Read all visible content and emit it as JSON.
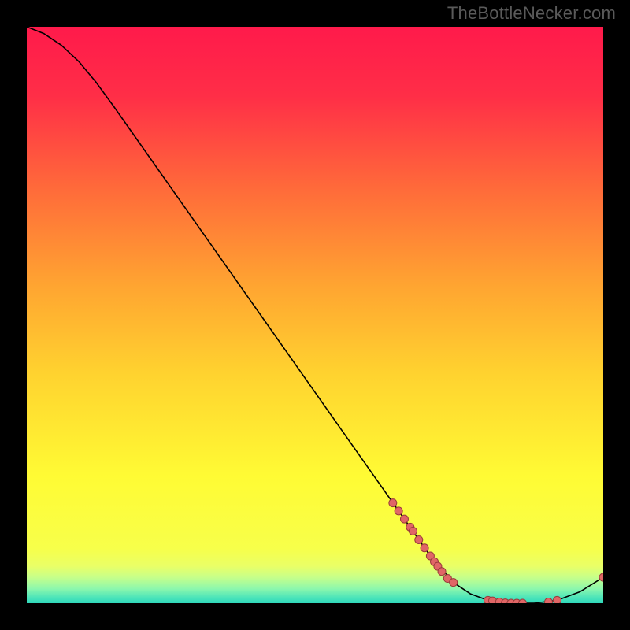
{
  "watermark": "TheBottleNecker.com",
  "chart_data": {
    "type": "line",
    "title": "",
    "xlabel": "",
    "ylabel": "",
    "xlim": [
      0,
      100
    ],
    "ylim": [
      0,
      100
    ],
    "gradient_stops": [
      {
        "offset": 0.0,
        "color": "#ff1a4b"
      },
      {
        "offset": 0.12,
        "color": "#ff2e47"
      },
      {
        "offset": 0.28,
        "color": "#ff6a3a"
      },
      {
        "offset": 0.45,
        "color": "#ffa531"
      },
      {
        "offset": 0.6,
        "color": "#ffd22f"
      },
      {
        "offset": 0.78,
        "color": "#fffb34"
      },
      {
        "offset": 0.905,
        "color": "#f7ff4a"
      },
      {
        "offset": 0.935,
        "color": "#eaff66"
      },
      {
        "offset": 0.955,
        "color": "#c7ff8a"
      },
      {
        "offset": 0.975,
        "color": "#8cf7ad"
      },
      {
        "offset": 0.99,
        "color": "#4de5b9"
      },
      {
        "offset": 1.0,
        "color": "#2fd8bb"
      }
    ],
    "series": [
      {
        "name": "curve",
        "stroke": "#000000",
        "points": [
          {
            "x": 0.0,
            "y": 100.0
          },
          {
            "x": 3.0,
            "y": 98.8
          },
          {
            "x": 6.0,
            "y": 96.8
          },
          {
            "x": 9.0,
            "y": 94.0
          },
          {
            "x": 12.0,
            "y": 90.4
          },
          {
            "x": 15.0,
            "y": 86.3
          },
          {
            "x": 20.0,
            "y": 79.2
          },
          {
            "x": 30.0,
            "y": 65.0
          },
          {
            "x": 40.0,
            "y": 50.8
          },
          {
            "x": 50.0,
            "y": 36.6
          },
          {
            "x": 60.0,
            "y": 22.4
          },
          {
            "x": 70.0,
            "y": 8.2
          },
          {
            "x": 74.0,
            "y": 3.6
          },
          {
            "x": 77.0,
            "y": 1.6
          },
          {
            "x": 80.0,
            "y": 0.5
          },
          {
            "x": 84.0,
            "y": 0.0
          },
          {
            "x": 88.0,
            "y": 0.0
          },
          {
            "x": 92.0,
            "y": 0.5
          },
          {
            "x": 96.0,
            "y": 2.0
          },
          {
            "x": 100.0,
            "y": 4.5
          }
        ]
      }
    ],
    "markers": {
      "fill": "#e06666",
      "stroke": "#9a3b3b",
      "radius_px": 5,
      "points": [
        {
          "x": 63.5,
          "y": 17.4
        },
        {
          "x": 64.5,
          "y": 16.0
        },
        {
          "x": 65.5,
          "y": 14.6
        },
        {
          "x": 66.5,
          "y": 13.2
        },
        {
          "x": 67.0,
          "y": 12.5
        },
        {
          "x": 68.0,
          "y": 11.0
        },
        {
          "x": 69.0,
          "y": 9.6
        },
        {
          "x": 70.0,
          "y": 8.2
        },
        {
          "x": 70.7,
          "y": 7.2
        },
        {
          "x": 71.3,
          "y": 6.4
        },
        {
          "x": 72.0,
          "y": 5.5
        },
        {
          "x": 73.0,
          "y": 4.3
        },
        {
          "x": 74.0,
          "y": 3.6
        },
        {
          "x": 80.0,
          "y": 0.5
        },
        {
          "x": 80.8,
          "y": 0.4
        },
        {
          "x": 82.0,
          "y": 0.2
        },
        {
          "x": 83.0,
          "y": 0.05
        },
        {
          "x": 84.0,
          "y": 0.0
        },
        {
          "x": 85.0,
          "y": 0.0
        },
        {
          "x": 86.0,
          "y": 0.0
        },
        {
          "x": 90.5,
          "y": 0.2
        },
        {
          "x": 92.0,
          "y": 0.5
        },
        {
          "x": 100.0,
          "y": 4.5
        }
      ]
    }
  }
}
